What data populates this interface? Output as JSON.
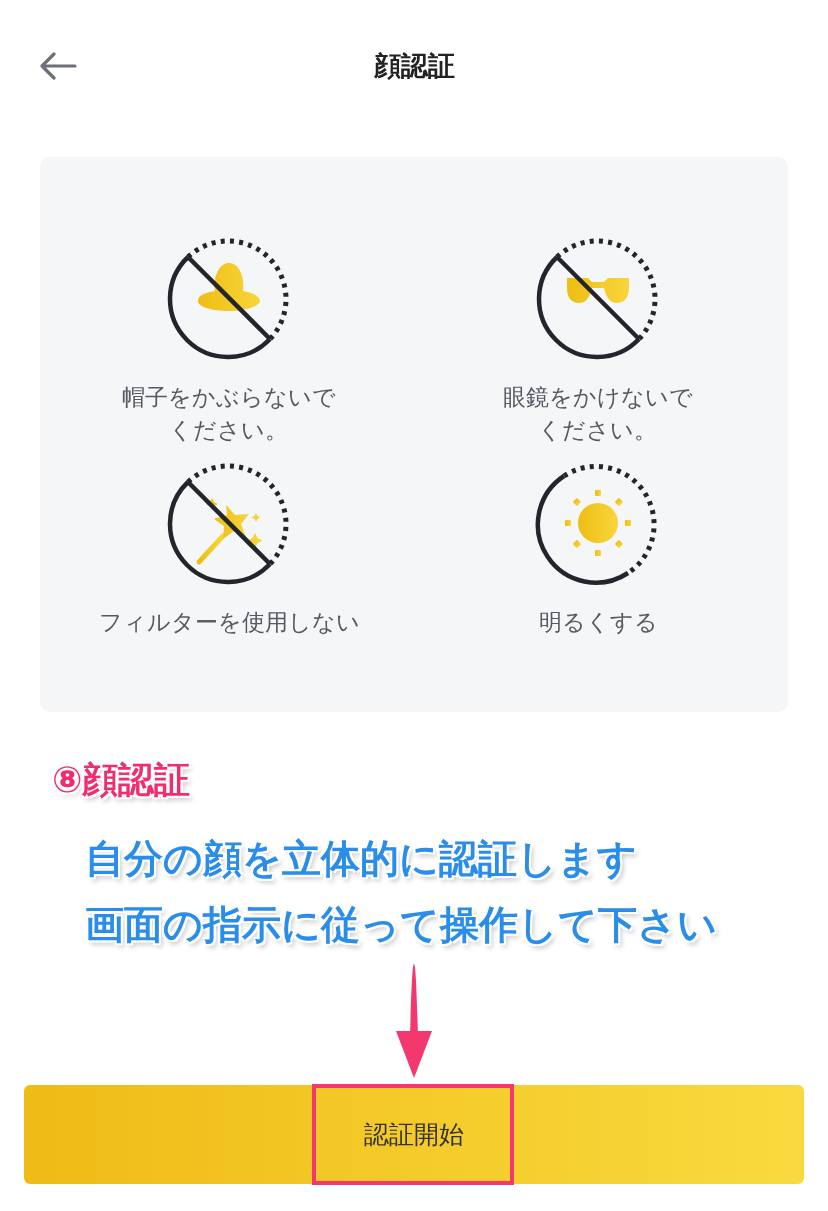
{
  "header": {
    "title": "顔認証"
  },
  "tips": [
    {
      "kind": "hat",
      "crossed": true,
      "label": "帽子をかぶらないでください。"
    },
    {
      "kind": "glasses",
      "crossed": true,
      "label": "眼鏡をかけないでください。"
    },
    {
      "kind": "wand",
      "crossed": true,
      "label": "フィルターを使用しない"
    },
    {
      "kind": "sun",
      "crossed": false,
      "label": "明るくする"
    }
  ],
  "annotation": {
    "heading": "⑧顔認証",
    "lines": [
      "自分の顔を立体的に認証します",
      "画面の指示に従って操作して下さい"
    ]
  },
  "start_button": {
    "label": "認証開始"
  }
}
